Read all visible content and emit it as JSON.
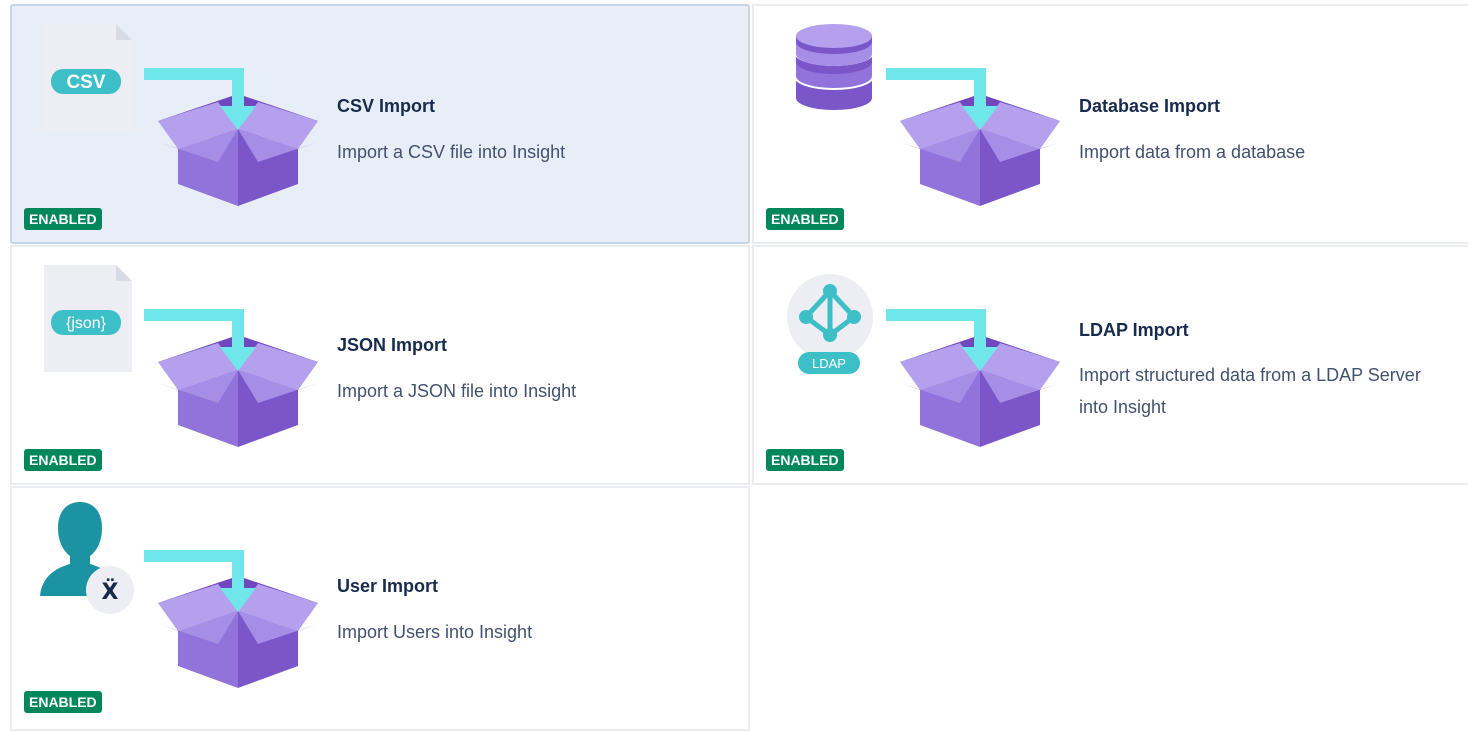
{
  "importers": [
    {
      "title": "CSV Import",
      "description": "Import a CSV file into Insight",
      "status": "ENABLED",
      "icon": "csv-file-icon",
      "icon_label": "CSV"
    },
    {
      "title": "Database Import",
      "description": "Import data from a database",
      "status": "ENABLED",
      "icon": "database-icon"
    },
    {
      "title": "JSON Import",
      "description": "Import a JSON file into Insight",
      "status": "ENABLED",
      "icon": "json-file-icon",
      "icon_label": "{json}"
    },
    {
      "title": "LDAP Import",
      "description": "Import structured data from a LDAP Server into Insight",
      "status": "ENABLED",
      "icon": "ldap-icon",
      "icon_label": "LDAP"
    },
    {
      "title": "User Import",
      "description": "Import Users into Insight",
      "status": "ENABLED",
      "icon": "user-icon"
    }
  ],
  "colors": {
    "box_light": "#b4a0ec",
    "box_mid": "#9272db",
    "box_dark": "#7a56c9",
    "box_inside": "#6f48c0",
    "arrow": "#6ee6ea",
    "badge": "#00875a",
    "selected_bg": "#e8eef7",
    "teal": "#3dbfc7"
  }
}
